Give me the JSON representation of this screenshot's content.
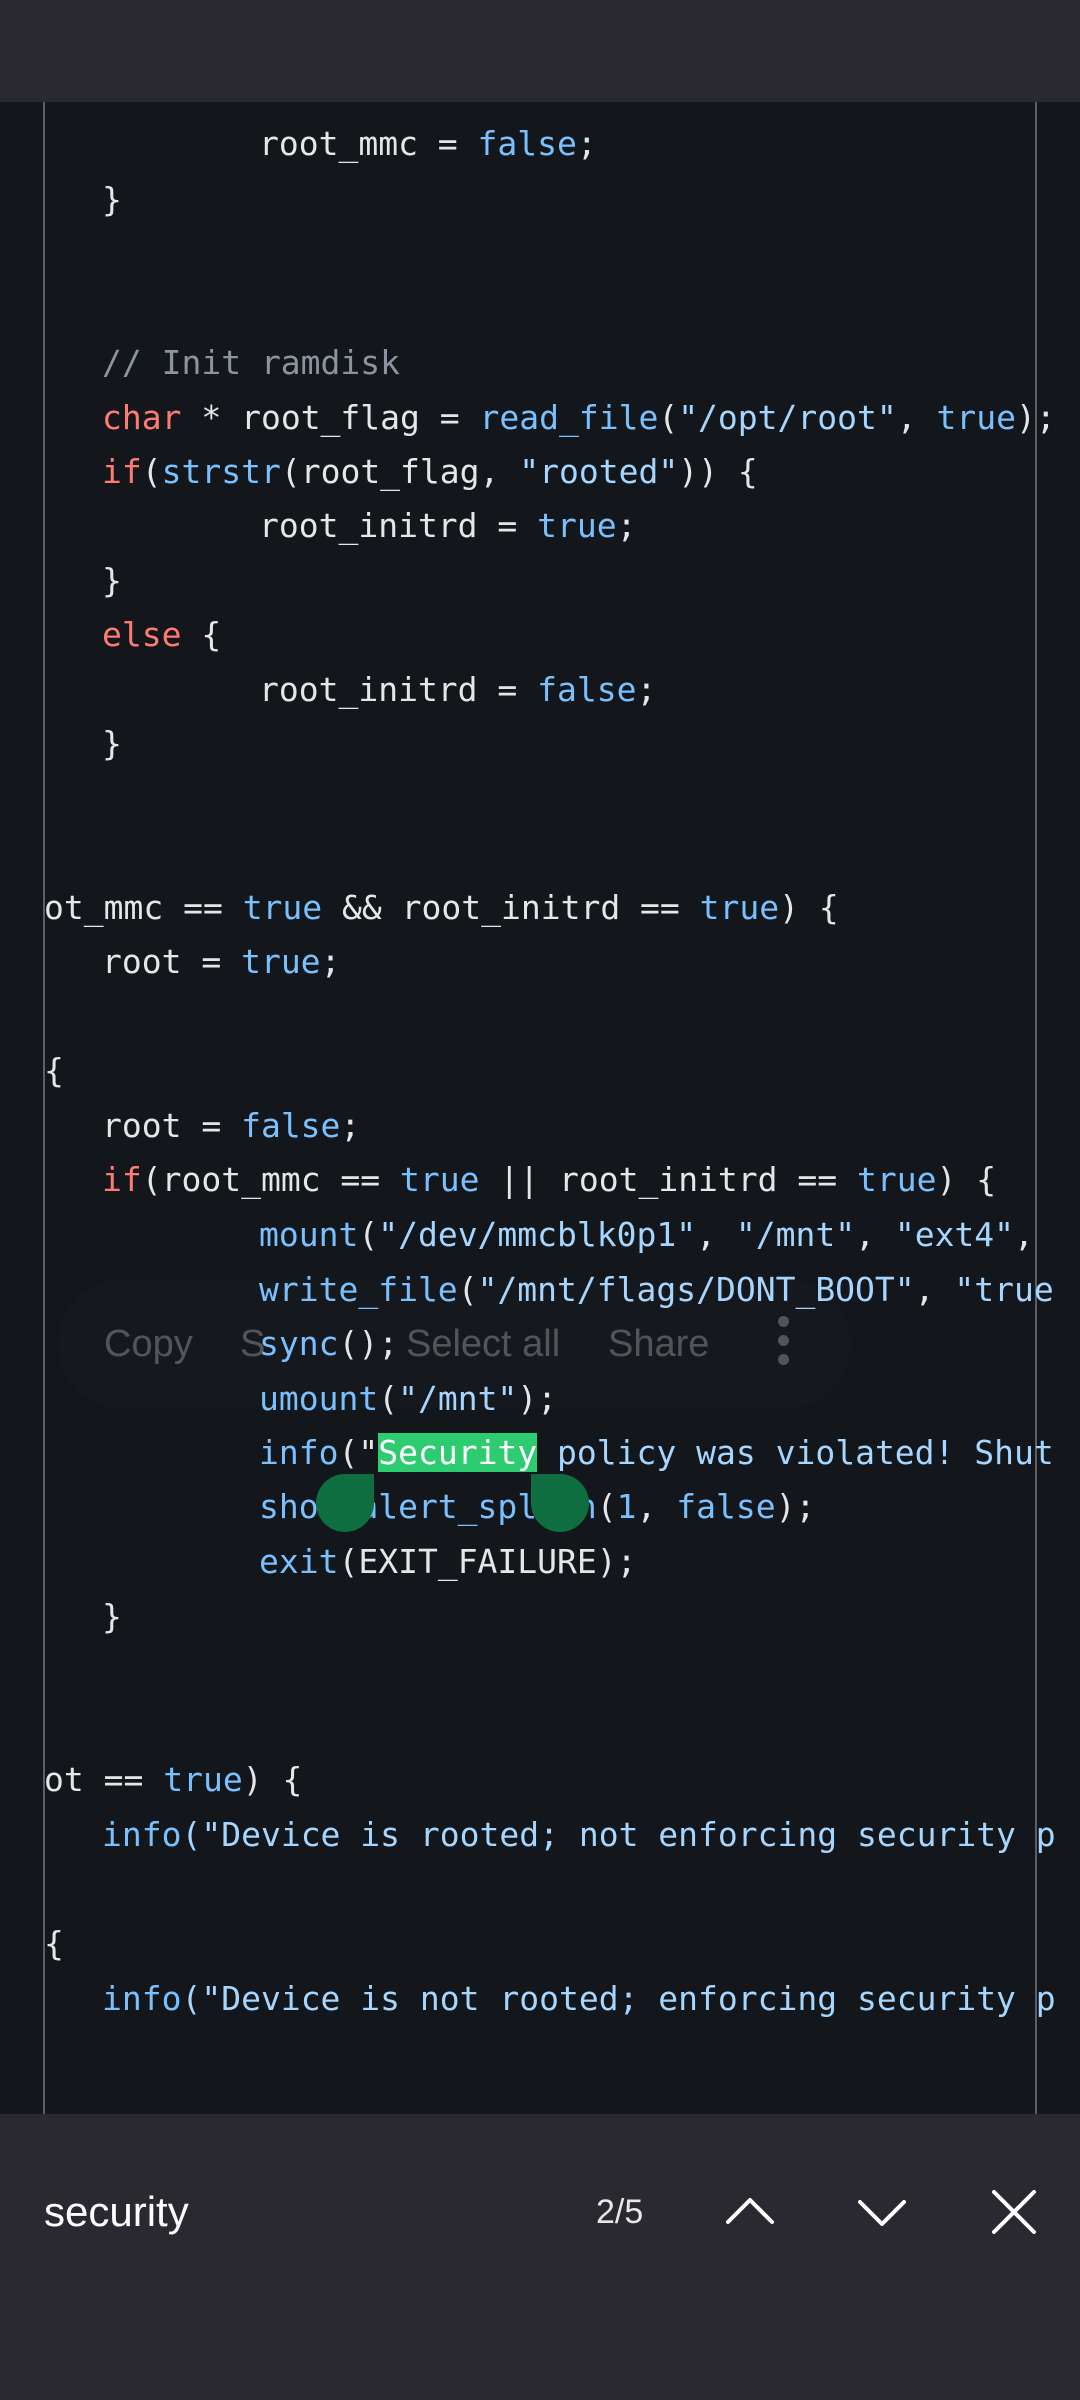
{
  "code_lines": [
    [
      {
        "t": "root_mmc = ",
        "c": "p"
      },
      {
        "t": "false",
        "c": "f"
      },
      {
        "t": ";",
        "c": "p"
      }
    ],
    [
      {
        "t": "}",
        "c": "p"
      }
    ],
    [
      {
        "t": "// Init ramdisk",
        "c": "c"
      }
    ],
    [
      {
        "t": "char",
        "c": "k"
      },
      {
        "t": " * root_flag = ",
        "c": "p"
      },
      {
        "t": "read_file",
        "c": "f"
      },
      {
        "t": "(",
        "c": "p"
      },
      {
        "t": "\"/opt/root\"",
        "c": "s"
      },
      {
        "t": ", ",
        "c": "p"
      },
      {
        "t": "true",
        "c": "f"
      },
      {
        "t": ");",
        "c": "p"
      }
    ],
    [
      {
        "t": "if",
        "c": "k"
      },
      {
        "t": "(",
        "c": "p"
      },
      {
        "t": "strstr",
        "c": "f"
      },
      {
        "t": "(root_flag, ",
        "c": "p"
      },
      {
        "t": "\"rooted\"",
        "c": "s"
      },
      {
        "t": ")) {",
        "c": "p"
      }
    ],
    [
      {
        "t": "root_initrd = ",
        "c": "p"
      },
      {
        "t": "true",
        "c": "f"
      },
      {
        "t": ";",
        "c": "p"
      }
    ],
    [
      {
        "t": "}",
        "c": "p"
      }
    ],
    [
      {
        "t": "else",
        "c": "k"
      },
      {
        "t": " {",
        "c": "p"
      }
    ],
    [
      {
        "t": "root_initrd = ",
        "c": "p"
      },
      {
        "t": "false",
        "c": "f"
      },
      {
        "t": ";",
        "c": "p"
      }
    ],
    [
      {
        "t": "}",
        "c": "p"
      }
    ],
    [
      {
        "t": "ot_mmc == ",
        "c": "p"
      },
      {
        "t": "true",
        "c": "f"
      },
      {
        "t": " && root_initrd == ",
        "c": "p"
      },
      {
        "t": "true",
        "c": "f"
      },
      {
        "t": ") {",
        "c": "p"
      }
    ],
    [
      {
        "t": "root = ",
        "c": "p"
      },
      {
        "t": "true",
        "c": "f"
      },
      {
        "t": ";",
        "c": "p"
      }
    ],
    [
      {
        "t": "{",
        "c": "p"
      }
    ],
    [
      {
        "t": "root = ",
        "c": "p"
      },
      {
        "t": "false",
        "c": "f"
      },
      {
        "t": ";",
        "c": "p"
      }
    ],
    [
      {
        "t": "if",
        "c": "k"
      },
      {
        "t": "(root_mmc == ",
        "c": "p"
      },
      {
        "t": "true",
        "c": "f"
      },
      {
        "t": " || root_initrd == ",
        "c": "p"
      },
      {
        "t": "true",
        "c": "f"
      },
      {
        "t": ") {",
        "c": "p"
      }
    ],
    [
      {
        "t": "mount",
        "c": "f"
      },
      {
        "t": "(",
        "c": "p"
      },
      {
        "t": "\"/dev/mmcblk0p1\"",
        "c": "s"
      },
      {
        "t": ", ",
        "c": "p"
      },
      {
        "t": "\"/mnt\"",
        "c": "s"
      },
      {
        "t": ", ",
        "c": "p"
      },
      {
        "t": "\"ext4\"",
        "c": "s"
      },
      {
        "t": ",",
        "c": "p"
      }
    ],
    [
      {
        "t": "write_file",
        "c": "f"
      },
      {
        "t": "(",
        "c": "p"
      },
      {
        "t": "\"/mnt/flags/DONT_BOOT\"",
        "c": "s"
      },
      {
        "t": ", ",
        "c": "p"
      },
      {
        "t": "\"true",
        "c": "s"
      }
    ],
    [
      {
        "t": "sync",
        "c": "f"
      },
      {
        "t": "();",
        "c": "p"
      }
    ],
    [
      {
        "t": "umount",
        "c": "f"
      },
      {
        "t": "(",
        "c": "p"
      },
      {
        "t": "\"/mnt\"",
        "c": "s"
      },
      {
        "t": ");",
        "c": "p"
      }
    ],
    [
      {
        "t": "info",
        "c": "f"
      },
      {
        "t": "(\"",
        "c": "p"
      },
      {
        "t": "Security",
        "c": "hl"
      },
      {
        "t": " policy was violated! Shut",
        "c": "s"
      }
    ],
    [
      {
        "t": "show_alert_splash",
        "c": "f"
      },
      {
        "t": "(",
        "c": "p"
      },
      {
        "t": "1",
        "c": "f"
      },
      {
        "t": ", ",
        "c": "p"
      },
      {
        "t": "false",
        "c": "f"
      },
      {
        "t": ");",
        "c": "p"
      }
    ],
    [
      {
        "t": "exit",
        "c": "f"
      },
      {
        "t": "(EXIT_FAILURE);",
        "c": "p"
      }
    ],
    [
      {
        "t": "}",
        "c": "p"
      }
    ],
    [
      {
        "t": "ot == ",
        "c": "p"
      },
      {
        "t": "true",
        "c": "f"
      },
      {
        "t": ") {",
        "c": "p"
      }
    ],
    [
      {
        "t": "info",
        "c": "f"
      },
      {
        "t": "(\"Device is rooted; not enforcing security p",
        "c": "s"
      }
    ],
    [
      {
        "t": "{",
        "c": "p"
      }
    ],
    [
      {
        "t": "info",
        "c": "f"
      },
      {
        "t": "(\"Device is not rooted; enforcing security p",
        "c": "s"
      }
    ]
  ],
  "selection_toolbar": {
    "copy": "Copy",
    "second": "S",
    "select_all": "Select all",
    "share": "Share",
    "more_icon": "more-vertical-icon"
  },
  "find_bar": {
    "query": "security",
    "match_count": "2/5",
    "prev_icon": "chevron-up-icon",
    "next_icon": "chevron-down-icon",
    "close_icon": "close-icon"
  },
  "colors": {
    "background": "#13161b",
    "keyword": "#ff7b72",
    "function": "#79c0ff",
    "comment": "#8b949e",
    "string": "#a5d6ff",
    "plain": "#e6e6e6",
    "highlight": "#2ecc71",
    "selection_handle": "#0f6e3f",
    "bars": "#2a2930"
  }
}
